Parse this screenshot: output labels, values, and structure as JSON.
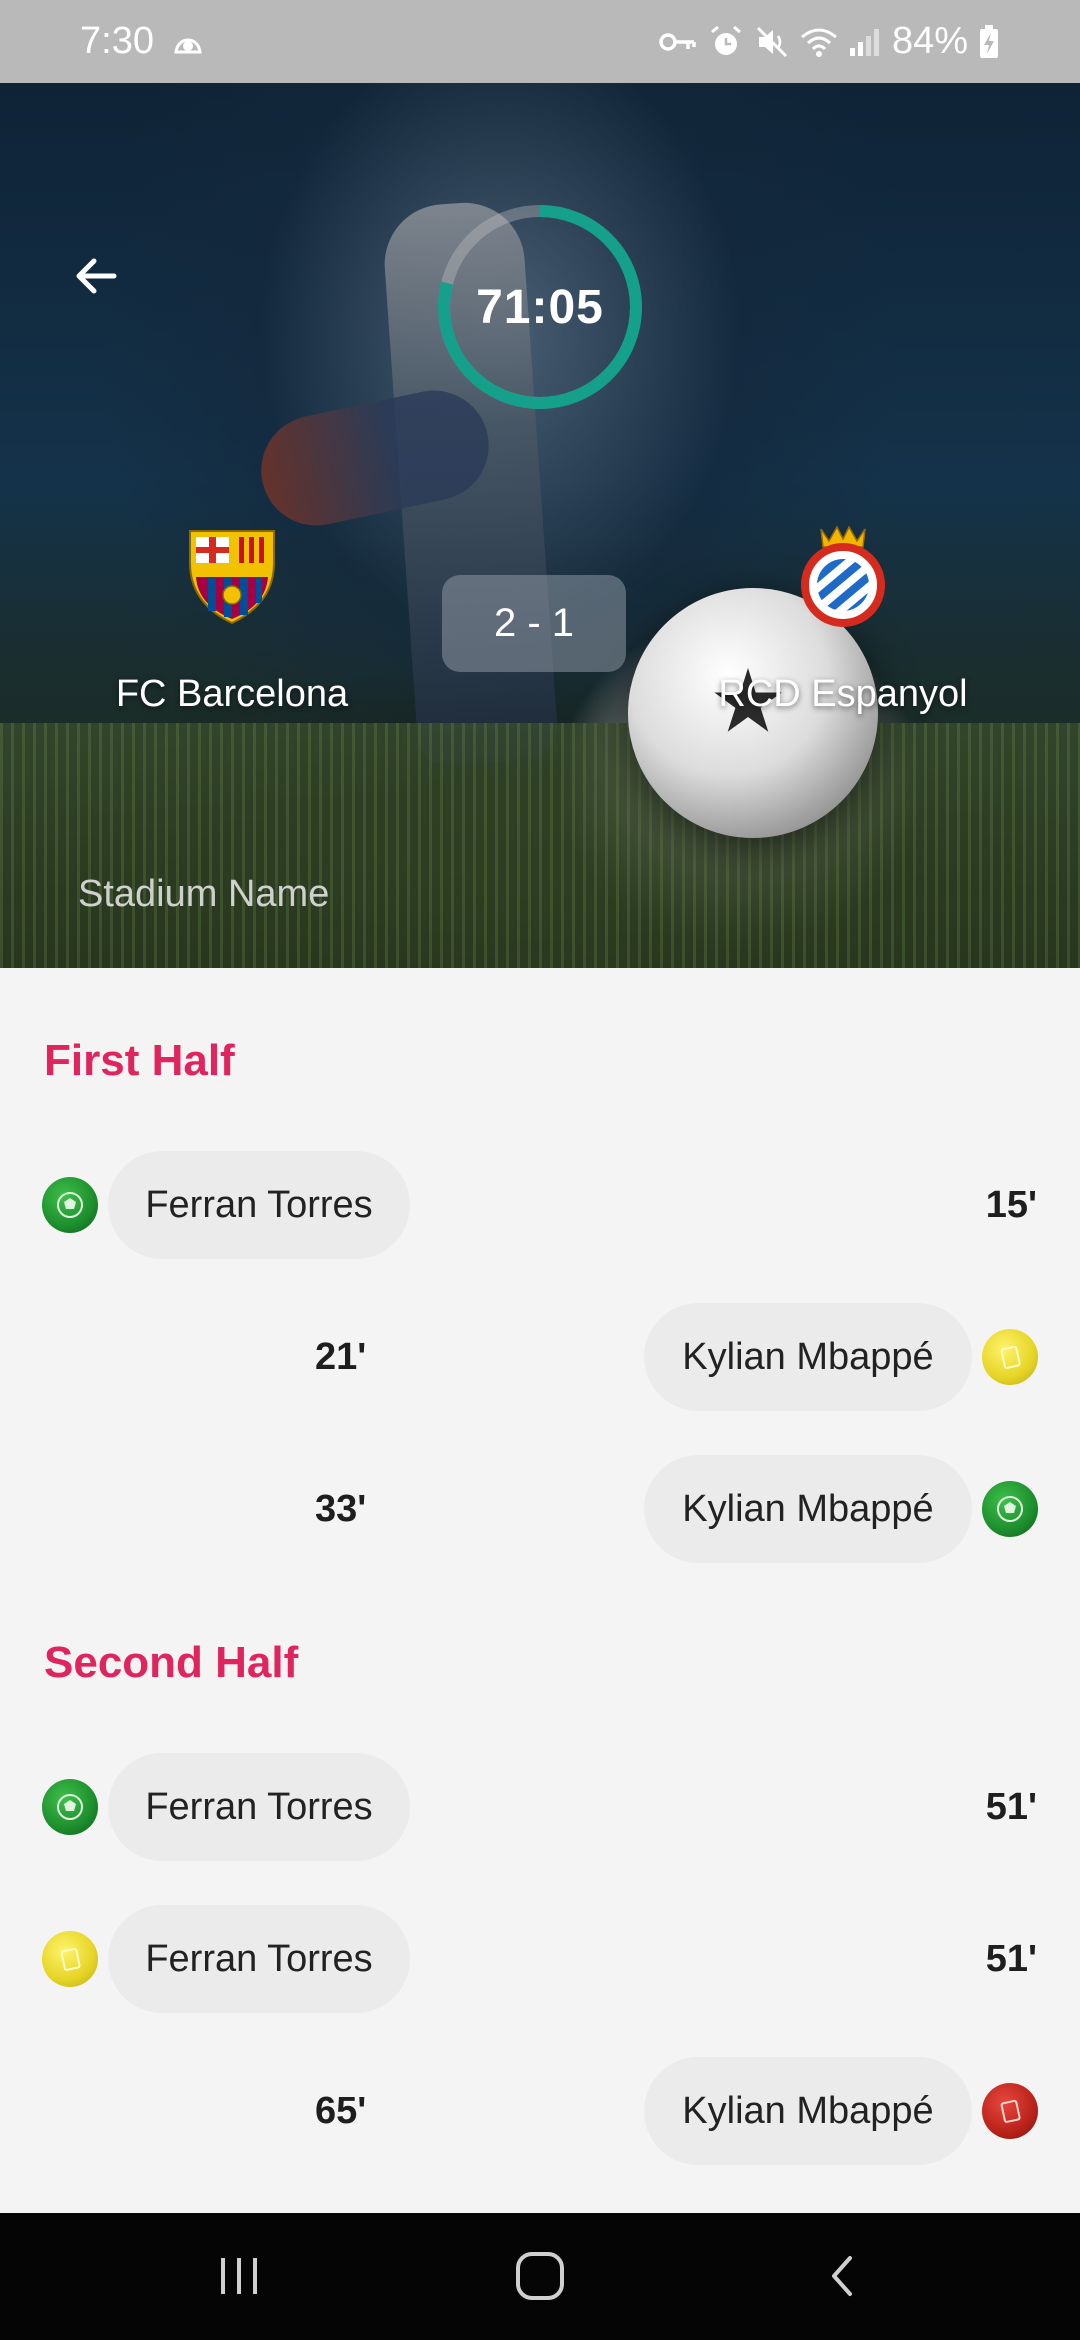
{
  "status_bar": {
    "time": "7:30",
    "battery": "84%",
    "icons": [
      "notification-icon",
      "vpn-key-icon",
      "alarm-icon",
      "mute-icon",
      "wifi-icon",
      "signal-icon",
      "battery-charging-icon"
    ]
  },
  "match": {
    "timer": "71:05",
    "timer_progress": 0.79,
    "score": "2 - 1",
    "home_team": "FC Barcelona",
    "away_team": "RCD Espanyol",
    "stadium": "Stadium Name"
  },
  "sections": [
    {
      "title": "First Half",
      "events": [
        {
          "side": "home",
          "player": "Ferran Torres",
          "minute": "15'",
          "type": "goal"
        },
        {
          "side": "away",
          "player": "Kylian Mbappé",
          "minute": "21'",
          "type": "yellow-card"
        },
        {
          "side": "away",
          "player": "Kylian Mbappé",
          "minute": "33'",
          "type": "goal"
        }
      ]
    },
    {
      "title": "Second Half",
      "events": [
        {
          "side": "home",
          "player": "Ferran Torres",
          "minute": "51'",
          "type": "goal"
        },
        {
          "side": "home",
          "player": "Ferran Torres",
          "minute": "51'",
          "type": "yellow-card"
        },
        {
          "side": "away",
          "player": "Kylian Mbappé",
          "minute": "65'",
          "type": "red-card"
        }
      ]
    }
  ],
  "colors": {
    "accent": "#e0245e",
    "timer_ring": "#14a08a",
    "status_bar": "#b9b9b9",
    "nav_bar": "#050505"
  }
}
